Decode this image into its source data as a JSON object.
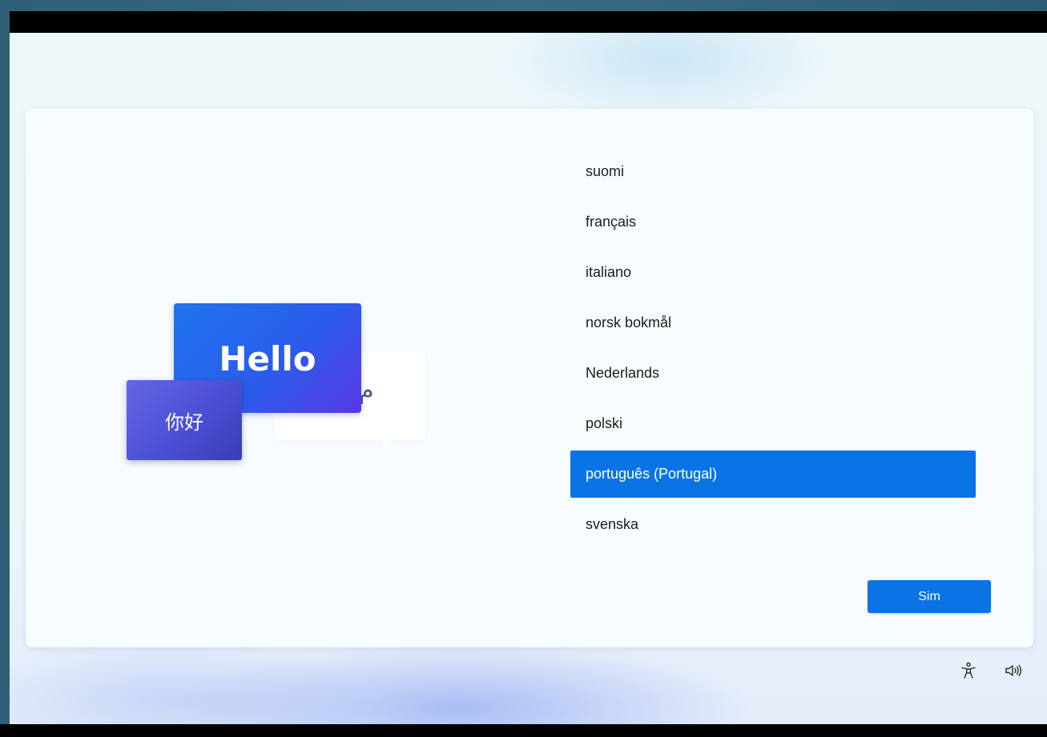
{
  "illustration": {
    "hello_text": "Hello",
    "nihao_text": "你好",
    "arabic_glyph": "م"
  },
  "languages": {
    "items": [
      {
        "label": "suomi"
      },
      {
        "label": "français"
      },
      {
        "label": "italiano"
      },
      {
        "label": "norsk bokmål"
      },
      {
        "label": "Nederlands"
      },
      {
        "label": "polski"
      },
      {
        "label": "português (Portugal)",
        "selected": true
      },
      {
        "label": "svenska"
      }
    ]
  },
  "actions": {
    "next_label": "Sim"
  },
  "tray": {
    "accessibility_icon": "accessibility-icon",
    "volume_icon": "volume-icon"
  },
  "colors": {
    "accent": "#0a74e6",
    "card_background": "#f7fcfe",
    "hello_bubble": "#2a5cec",
    "nihao_bubble": "#4b4fd4"
  }
}
